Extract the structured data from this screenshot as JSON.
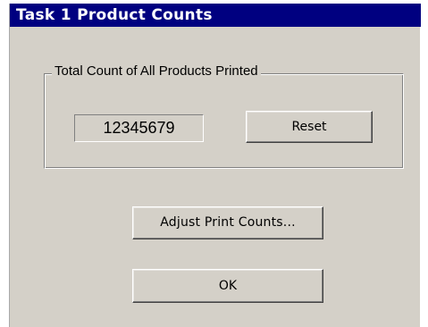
{
  "window": {
    "title": "Task 1 Product Counts"
  },
  "group": {
    "label": "Total Count of All Products Printed",
    "count_value": "12345679",
    "reset_label": "Reset"
  },
  "actions": {
    "adjust_label": "Adjust Print Counts...",
    "ok_label": "OK"
  },
  "colors": {
    "titlebar": "#000080",
    "title_text": "#ffffff",
    "dialog_bg": "#d4d0c8"
  }
}
